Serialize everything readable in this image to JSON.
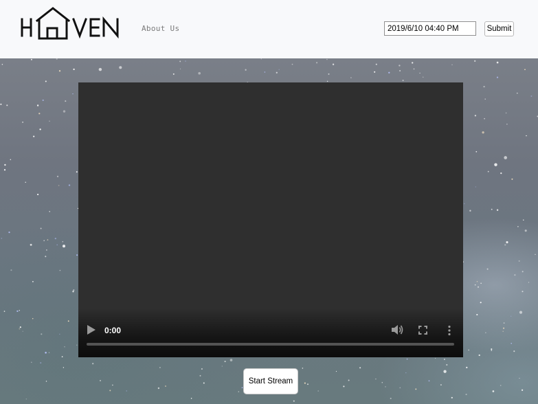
{
  "header": {
    "logo_text": "HAVEN",
    "about_link": "About Us",
    "datetime_value": "2019/6/10 04:40 PM",
    "submit_label": "Submit"
  },
  "video": {
    "current_time": "0:00",
    "progress": 0,
    "play_icon": "play-icon",
    "volume_icon": "volume-icon",
    "fullscreen_icon": "fullscreen-icon",
    "more_icon": "more-options-icon"
  },
  "actions": {
    "start_stream_label": "Start Stream"
  },
  "colors": {
    "navbar": "#f8f9fb",
    "video_bg": "#2f2f2f",
    "logo": "#111111"
  }
}
